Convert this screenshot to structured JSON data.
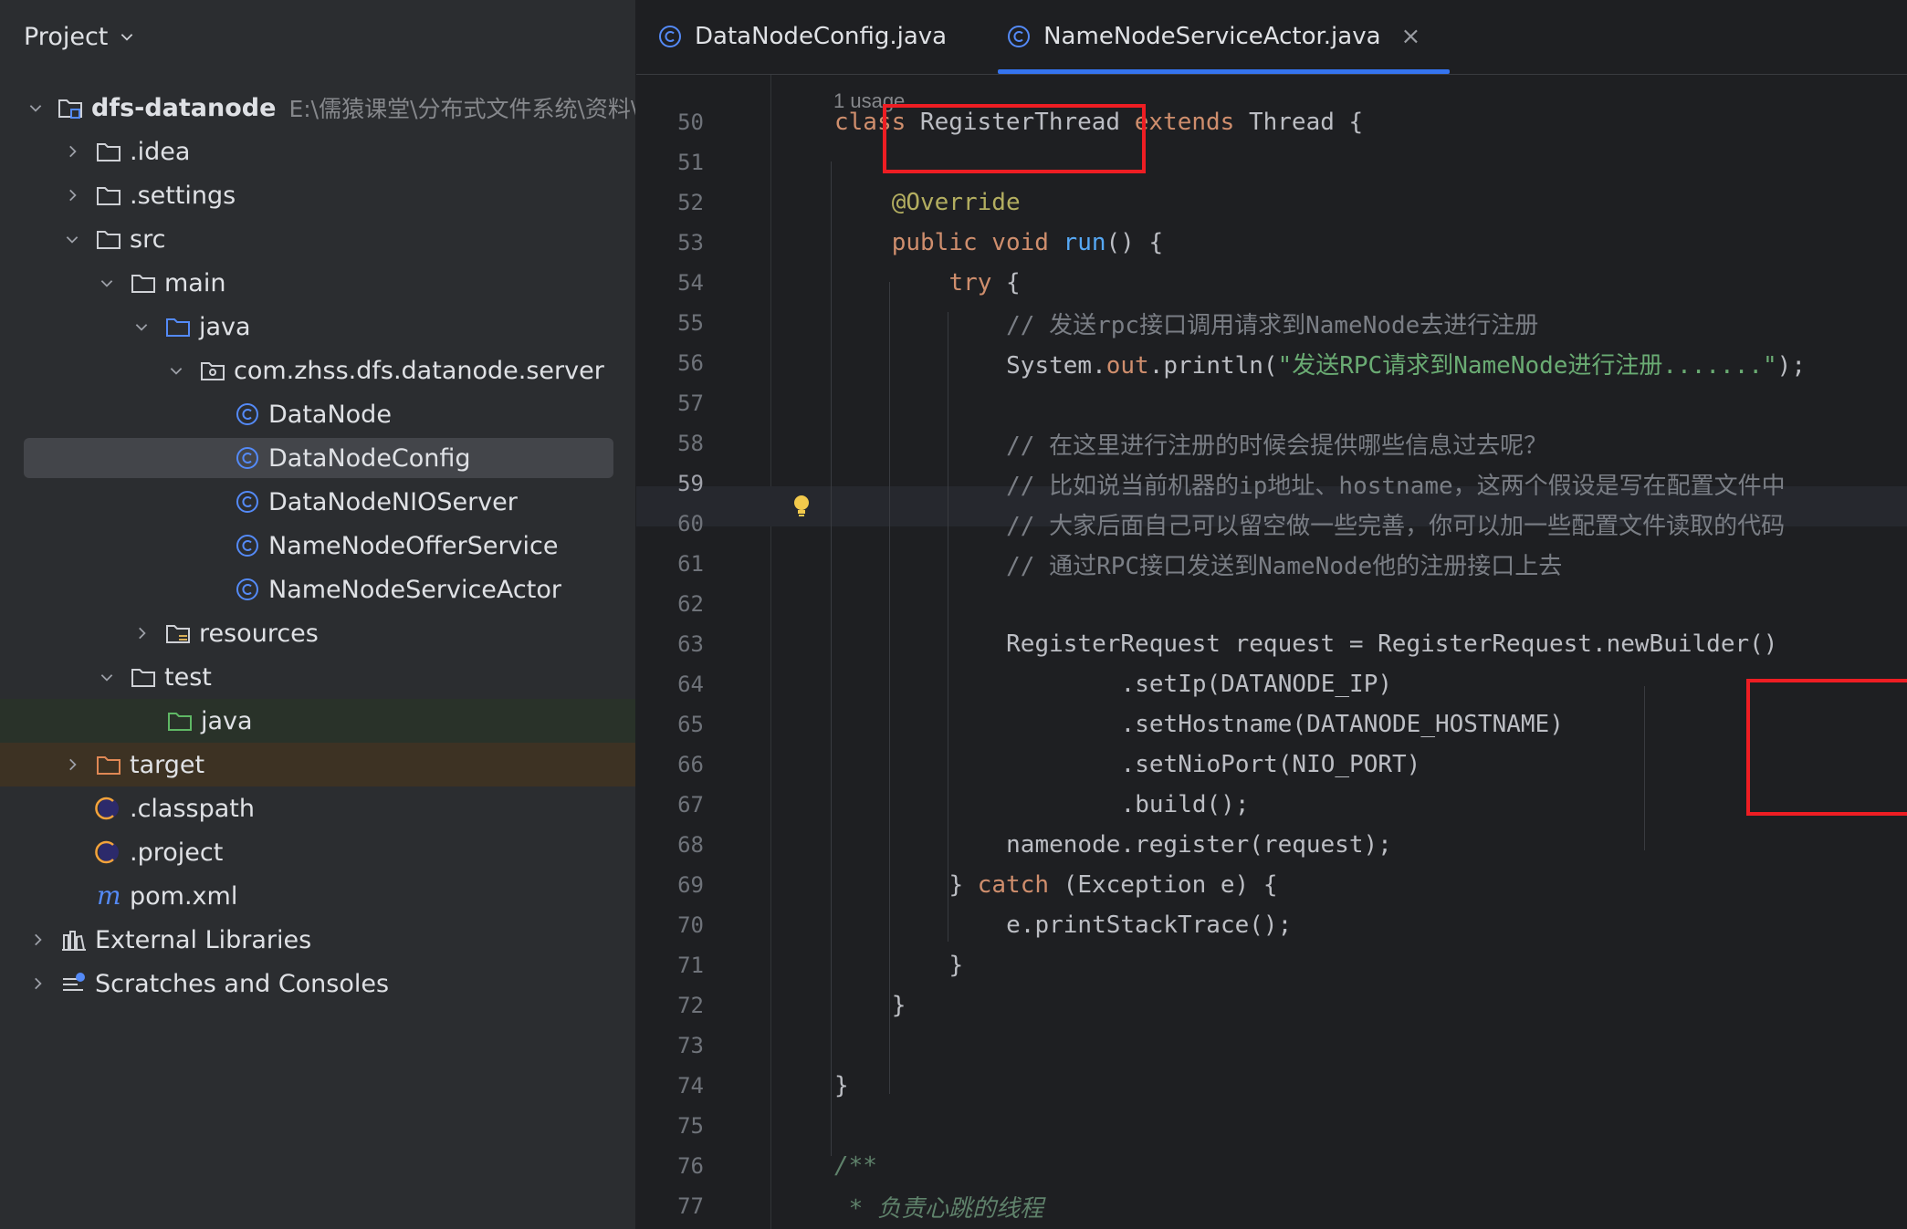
{
  "project_panel": {
    "title": "Project",
    "tree": [
      {
        "label": "dfs-datanode",
        "hint": "E:\\儒猿课堂\\分布式文件系统\\资料\\"
      },
      {
        "label": ".idea"
      },
      {
        "label": ".settings"
      },
      {
        "label": "src"
      },
      {
        "label": "main"
      },
      {
        "label": "java"
      },
      {
        "label": "com.zhss.dfs.datanode.server"
      },
      {
        "label": "DataNode"
      },
      {
        "label": "DataNodeConfig"
      },
      {
        "label": "DataNodeNIOServer"
      },
      {
        "label": "NameNodeOfferService"
      },
      {
        "label": "NameNodeServiceActor"
      },
      {
        "label": "resources"
      },
      {
        "label": "test"
      },
      {
        "label": "java"
      },
      {
        "label": "target"
      },
      {
        "label": ".classpath"
      },
      {
        "label": ".project"
      },
      {
        "label": "pom.xml"
      },
      {
        "label": "External Libraries"
      },
      {
        "label": "Scratches and Consoles"
      }
    ]
  },
  "tabs": [
    {
      "label": "DataNodeConfig.java"
    },
    {
      "label": "NameNodeServiceActor.java",
      "close": "×"
    }
  ],
  "editor": {
    "usage_hint": "1 usage",
    "line_numbers": [
      "50",
      "51",
      "52",
      "53",
      "54",
      "55",
      "56",
      "57",
      "58",
      "59",
      "60",
      "61",
      "62",
      "63",
      "64",
      "65",
      "66",
      "67",
      "68",
      "69",
      "70",
      "71",
      "72",
      "73",
      "74",
      "75",
      "76",
      "77"
    ],
    "code": {
      "l50": {
        "kw1": "class",
        "name": " RegisterThread ",
        "kw2": "extends",
        "rest": " Thread {"
      },
      "l52": "@Override",
      "l53": {
        "kw": "public void",
        "fn": " run",
        "rest": "() {"
      },
      "l54": {
        "kw": "try",
        "rest": " {"
      },
      "l55": "// 发送rpc接口调用请求到NameNode去进行注册",
      "l56": {
        "pre": "System.",
        "field": "out",
        "mid": ".println(",
        "str": "\"发送RPC请求到NameNode进行注册.......\"",
        "post": ");"
      },
      "l58": "// 在这里进行注册的时候会提供哪些信息过去呢？",
      "l59": "// 比如说当前机器的ip地址、hostname，这两个假设是写在配置文件中",
      "l60": "// 大家后面自己可以留空做一些完善，你可以加一些配置文件读取的代码",
      "l61": "// 通过RPC接口发送到NameNode他的注册接口上去",
      "l63": "RegisterRequest request = RegisterRequest.newBuilder()",
      "l64": ".setIp(DATANODE_IP)",
      "l65": ".setHostname(DATANODE_HOSTNAME)",
      "l66": ".setNioPort(NIO_PORT)",
      "l67": ".build();",
      "l68": "namenode.register(request);",
      "l69": {
        "pre": "} ",
        "kw": "catch",
        "rest": " (Exception e) {"
      },
      "l70": "e.printStackTrace();",
      "l71": "}",
      "l72": "}",
      "l74": "}",
      "l76": "/**",
      "l77": " * 负责心跳的线程"
    }
  },
  "colors": {
    "accent": "#3574f0",
    "highlight_box": "#ee1d23",
    "keyword": "#cf8e6d",
    "string": "#6aab73",
    "comment": "#7a7e85"
  }
}
